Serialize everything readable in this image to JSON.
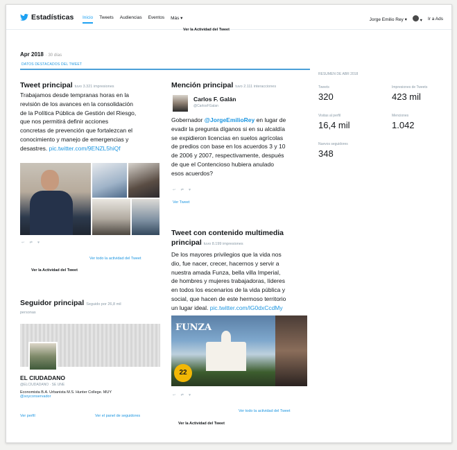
{
  "nav": {
    "brand": "Estadísticas",
    "links": [
      "Inicio",
      "Tweets",
      "Audiencias",
      "Eventos",
      "Más ▾"
    ],
    "user": "Jorge Emilio Rey ▾",
    "ads": "Ir a Ads"
  },
  "banner_link": "Ver la Actividad del Tweet",
  "period": {
    "month": "Apr 2018",
    "days": "· 30 días"
  },
  "highlights_label": "DATOS DESTACADOS DEL TWEET",
  "top_tweet": {
    "title": "Tweet principal",
    "meta": "tuvo 3.321 impresiones",
    "lines": [
      "Trabajamos desde tempranas horas en la",
      "revisión de los avances en la consolidación",
      "de la Política Pública de Gestión del Riesgo,",
      "que nos permitirá definir acciones",
      "concretas de prevención que fortalezcan el",
      "conocimiento y manejo de emergencias y",
      "desastres."
    ],
    "link": "pic.twitter.com/9ENZL5hiQf",
    "view_all": "Ver todo la actividad del Tweet",
    "activity": "Ver la Actividad del Tweet"
  },
  "top_follower": {
    "title": "Seguidor principal",
    "meta": "Seguido por 26,8 mil",
    "sub": "personas",
    "name": "EL CIUDADANO",
    "handle": "@ELCIUDADANO · SE UNE",
    "bio": "Economista B.A. Urbanista M.S. Hunter College. MUY",
    "bio_link": "@soyconservador",
    "view_profile": "Ver perfil",
    "followers_dash": "Ver el panel de seguidores"
  },
  "top_mention": {
    "title": "Mención principal",
    "meta": "tuvo 2.111 interacciones",
    "author": "Carlos F. Galán",
    "handle": "@CarlosFGalan",
    "text_before": "Gobernador ",
    "mention": "@JorgeEmilioRey",
    "text_lines": [
      " en lugar de",
      "evadir la pregunta díganos si en su alcaldía",
      "se expidieron licencias en suelos agrícolas",
      "de predios con base en los acuerdos 3 y 10",
      "de 2006 y 2007, respectivamente, después",
      "de que el Contencioso hubiera anulado",
      "esos acuerdos?"
    ],
    "view_tweet": "Ver Tweet"
  },
  "top_media": {
    "title_line1": "Tweet con contenido multimedia",
    "title_line2": "principal",
    "meta": "tuvo 8.199 impresiones",
    "lines": [
      "De los mayores privilegios que la vida nos",
      "dio, fue nacer, crecer, hacernos y servir a",
      "nuestra amada Funza, bella villa Imperial,",
      "de hombres y mujeres trabajadoras, líderes",
      "en todos los escenarios de la vida pública y",
      "social, que hacen de este hermoso territorio"
    ],
    "last_line": "un lugar ideal.",
    "link": "pic.twitter.com/lG0dxCcdMy",
    "image_text": "FUNZA",
    "image_badge": "22",
    "view_all": "Ver todo la actividad del Tweet",
    "activity": "Ver la Actividad del Tweet"
  },
  "summary": {
    "title": "RESUMEN DE ABR 2018",
    "items": [
      {
        "label": "Tweets",
        "value": "320"
      },
      {
        "label": "Impresiones de Tweets",
        "value": "423 mil"
      },
      {
        "label": "Visitas al perfil",
        "value": "16,4 mil"
      },
      {
        "label": "Menciones",
        "value": "1.042"
      },
      {
        "label": "Nuevos seguidores",
        "value": "348"
      }
    ]
  },
  "colors": {
    "accent": "#1da1f2",
    "link": "#1b95e0",
    "divider": "#4a9fd8"
  }
}
